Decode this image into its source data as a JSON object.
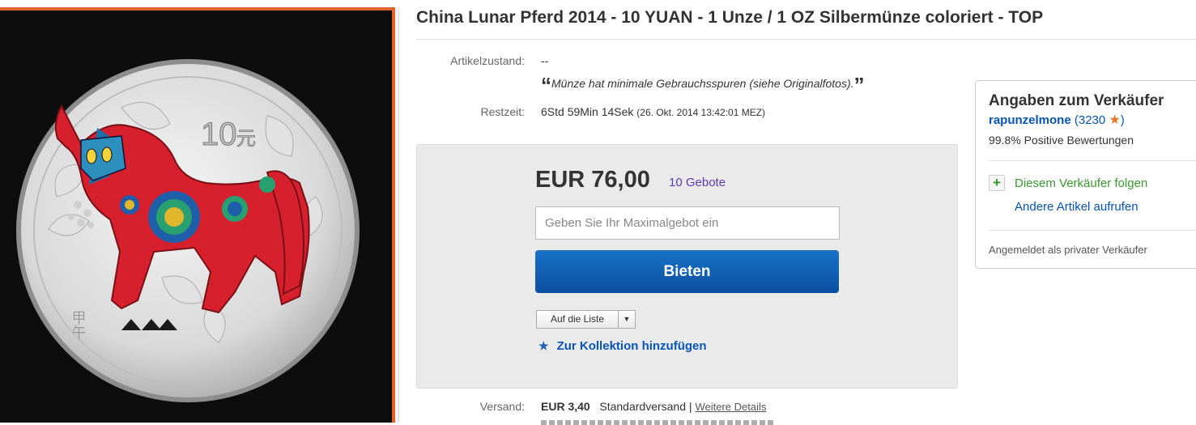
{
  "listing": {
    "title": "China Lunar Pferd 2014 - 10 YUAN - 1 Unze / 1 OZ Silbermünze coloriert - TOP",
    "condition_label": "Artikelzustand:",
    "condition_value": "--",
    "condition_quote": "Münze hat minimale Gebrauchsspuren (siehe Originalfotos).",
    "time_label": "Restzeit:",
    "time_remaining": "6Std 59Min 14Sek",
    "time_end": "(26. Okt. 2014   13:42:01 MEZ)"
  },
  "coin_image": {
    "denomination": "10",
    "currency_char": "元",
    "year_chars": "甲午"
  },
  "bid": {
    "price": "EUR 76,00",
    "bid_count": "10 Gebote",
    "max_bid_placeholder": "Geben Sie Ihr Maximalgebot ein",
    "bid_button": "Bieten",
    "watch_button": "Auf die Liste",
    "collection_link": "Zur Kollektion hinzufügen"
  },
  "shipping": {
    "label": "Versand:",
    "cost": "EUR 3,40",
    "method": "Standardversand",
    "separator": "|",
    "details_link": "Weitere Details"
  },
  "seller": {
    "heading": "Angaben zum Verkäufer",
    "username": "rapunzelmone",
    "score_open": "(",
    "score": "3230",
    "score_close": ")",
    "feedback": "99.8% Positive Bewertungen",
    "follow_label": "Diesem Verkäufer folgen",
    "other_items": "Andere Artikel aufrufen",
    "seller_type": "Angemeldet als privater Verkäufer"
  },
  "colors": {
    "accent_orange": "#e2622b",
    "link_blue": "#0654ba",
    "bid_button_blue": "#0b4fa0",
    "bid_count_purple": "#5d3bb1",
    "follow_green": "#3a9a2e"
  }
}
